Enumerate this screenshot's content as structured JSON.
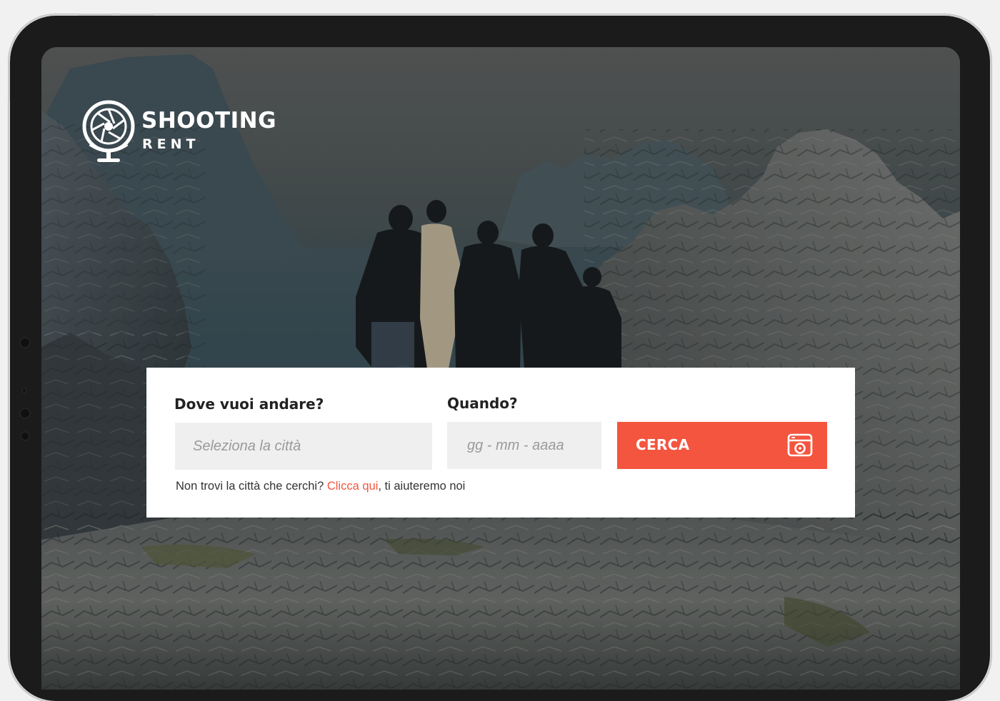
{
  "brand": {
    "name": "SHOOTING",
    "tagline": "RENT",
    "logo_icon": "camera-shutter-globe-icon"
  },
  "search": {
    "destination_label": "Dove vuoi andare?",
    "destination_placeholder": "Seleziona la città",
    "date_label": "Quando?",
    "date_placeholder": "gg - mm - aaaa",
    "submit_label": "CERCA",
    "submit_icon": "camera-icon"
  },
  "help": {
    "prefix": "Non trovi la città che cerchi? ",
    "link_text": "Clicca qui",
    "suffix": ", ti aiuteremo noi"
  },
  "colors": {
    "accent": "#f4553f",
    "panel_bg": "#ffffff",
    "input_bg": "#efefef",
    "text_dark": "#222222"
  }
}
